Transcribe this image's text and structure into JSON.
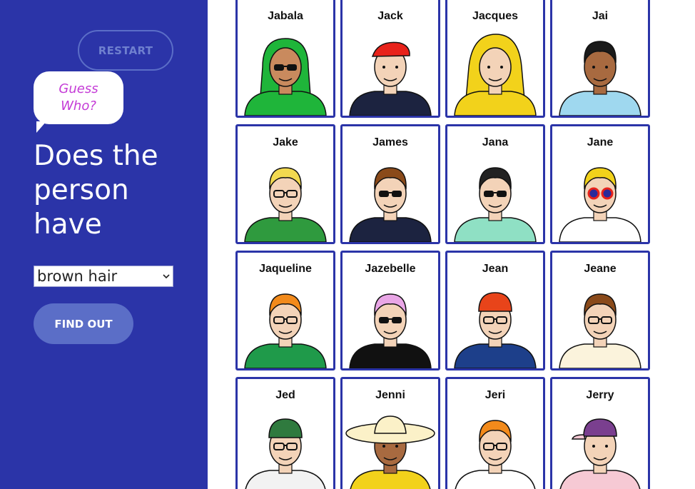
{
  "sidebar": {
    "restart_label": "RESTART",
    "bubble_line1": "Guess",
    "bubble_line2": "Who?",
    "question": "Does the person have",
    "selected_option": "brown hair",
    "find_label": "FIND OUT"
  },
  "colors": {
    "sidebar_bg": "#2b34a8",
    "accent_button": "#5b6ec7",
    "bubble_text": "#c43bd6",
    "card_border": "#2b34a8"
  },
  "characters": [
    {
      "name": "Jabala",
      "skin": "#c98a5e",
      "hair": "#1fb53a",
      "shirt": "#1fb53a",
      "glasses": "sun",
      "hat": "hijab"
    },
    {
      "name": "Jack",
      "skin": "#f3d3b8",
      "hair": "#8a4a1a",
      "shirt": "#1c2340",
      "glasses": "none",
      "hat": "bandana"
    },
    {
      "name": "Jacques",
      "skin": "#f3d3b8",
      "hair": "#f2d21b",
      "shirt": "#f2d21b",
      "glasses": "none",
      "hat": "raincoat"
    },
    {
      "name": "Jai",
      "skin": "#a86a40",
      "hair": "#1a1a1a",
      "shirt": "#9fd8ef",
      "glasses": "none",
      "hat": "none"
    },
    {
      "name": "Jake",
      "skin": "#f3d3b8",
      "hair": "#f2d950",
      "shirt": "#2f9a3e",
      "glasses": "black",
      "hat": "none"
    },
    {
      "name": "James",
      "skin": "#f3d3b8",
      "hair": "#8a4a1a",
      "shirt": "#1c2340",
      "glasses": "sun",
      "hat": "none"
    },
    {
      "name": "Jana",
      "skin": "#f3d3b8",
      "hair": "#222222",
      "shirt": "#8fe0c4",
      "glasses": "sun",
      "hat": "none"
    },
    {
      "name": "Jane",
      "skin": "#f3d3b8",
      "hair": "#f2d21b",
      "shirt": "#ffffff",
      "glasses": "red",
      "hat": "none"
    },
    {
      "name": "Jaqueline",
      "skin": "#f3d3b8",
      "hair": "#f28a1b",
      "shirt": "#1f9a4a",
      "glasses": "black",
      "hat": "none"
    },
    {
      "name": "Jazebelle",
      "skin": "#f3d3b8",
      "hair": "#e9a6e6",
      "shirt": "#111111",
      "glasses": "sun",
      "hat": "none"
    },
    {
      "name": "Jean",
      "skin": "#f3d3b8",
      "hair": "#e8441a",
      "shirt": "#1d3f8a",
      "glasses": "black",
      "hat": "beanie"
    },
    {
      "name": "Jeane",
      "skin": "#f3d3b8",
      "hair": "#8a4a1a",
      "shirt": "#fbf3dc",
      "glasses": "black",
      "hat": "none"
    },
    {
      "name": "Jed",
      "skin": "#f3d3b8",
      "hair": "#f28a1b",
      "shirt": "#f2f2f2",
      "glasses": "black",
      "hat": "green-beanie"
    },
    {
      "name": "Jenni",
      "skin": "#a86a40",
      "hair": "#222222",
      "shirt": "#f2d21b",
      "glasses": "none",
      "hat": "sunhat"
    },
    {
      "name": "Jeri",
      "skin": "#f3d3b8",
      "hair": "#f28a1b",
      "shirt": "#ffffff",
      "glasses": "black",
      "hat": "none"
    },
    {
      "name": "Jerry",
      "skin": "#f3d3b8",
      "hair": "#6b6b6b",
      "shirt": "#f6c9d4",
      "glasses": "none",
      "hat": "cap"
    }
  ]
}
